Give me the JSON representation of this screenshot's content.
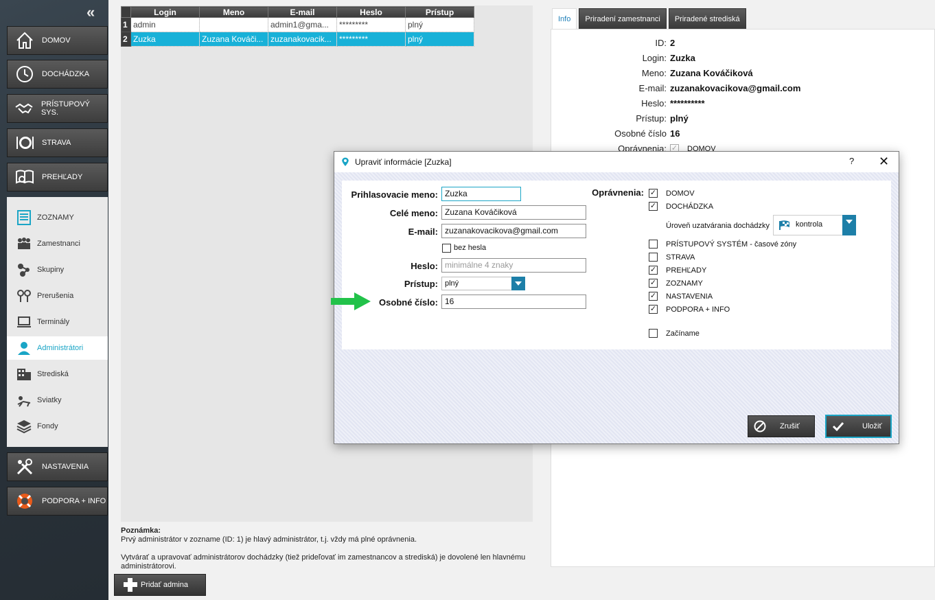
{
  "sidebar": {
    "collapse_icon": "«",
    "main_items": [
      {
        "label": "DOMOV",
        "icon": "home-icon"
      },
      {
        "label": "DOCHÁDZKA",
        "icon": "clock-icon"
      },
      {
        "label": "PRÍSTUPOVÝ SYS.",
        "icon": "handshake-icon"
      },
      {
        "label": "STRAVA",
        "icon": "plate-icon"
      },
      {
        "label": "PREHĽADY",
        "icon": "book-search-icon"
      }
    ],
    "sub_items": [
      {
        "label": "ZOZNAMY",
        "icon": "list-icon"
      },
      {
        "label": "Zamestnanci",
        "icon": "people-icon"
      },
      {
        "label": "Skupiny",
        "icon": "groups-icon"
      },
      {
        "label": "Prerušenia",
        "icon": "pins-icon"
      },
      {
        "label": "Terminály",
        "icon": "laptop-icon"
      },
      {
        "label": "Administrátori",
        "icon": "admin-user-icon"
      },
      {
        "label": "Strediská",
        "icon": "building-icon"
      },
      {
        "label": "Sviatky",
        "icon": "lounger-icon"
      },
      {
        "label": "Fondy",
        "icon": "layers-icon"
      }
    ],
    "bottom_items": [
      {
        "label": "NASTAVENIA",
        "icon": "tools-icon"
      },
      {
        "label": "PODPORA + INFO",
        "icon": "lifebuoy-icon"
      }
    ]
  },
  "grid": {
    "columns": [
      "Login",
      "Meno",
      "E-mail",
      "Heslo",
      "Prístup"
    ],
    "rows": [
      {
        "num": "1",
        "login": "admin",
        "meno": "",
        "email": "admin1@gma...",
        "heslo": "*********",
        "pristup": "plný"
      },
      {
        "num": "2",
        "login": "Zuzka",
        "meno": "Zuzana Kováči...",
        "email": "zuzanakovacik...",
        "heslo": "*********",
        "pristup": "plný"
      }
    ]
  },
  "note": {
    "title": "Poznámka:",
    "line1": "Prvý administrátor v zozname (ID: 1) je hlavý administrátor, t.j. vždy má plné oprávnenia.",
    "line2": "Vytvárať a upravovať administrátorov dochádzky (tiež prideľovať im zamestnancov a strediská) je dovolené len hlavnému administrátorovi."
  },
  "add_button": "Pridať admina",
  "tabs": [
    "Info",
    "Priradení zamestnanci",
    "Priradené strediská"
  ],
  "detail": [
    {
      "label": "ID:",
      "value": "2"
    },
    {
      "label": "Login:",
      "value": "Zuzka"
    },
    {
      "label": "Meno:",
      "value": "Zuzana Kováčiková"
    },
    {
      "label": "E-mail:",
      "value": "zuzanakovacikova@gmail.com"
    },
    {
      "label": "Heslo:",
      "value": "**********"
    },
    {
      "label": "Prístup:",
      "value": "plný"
    },
    {
      "label": "Osobné číslo",
      "value": "16"
    }
  ],
  "detail_perm": {
    "label": "Oprávnenia:",
    "item": "DOMOV"
  },
  "dialog": {
    "title": "Upraviť informácie [Zuzka]",
    "help": "?",
    "close": "✕",
    "fields": {
      "login_label": "Prihlasovacie meno:",
      "login_value": "Zuzka",
      "name_label": "Celé meno:",
      "name_value": "Zuzana Kováčiková",
      "email_label": "E-mail:",
      "email_value": "zuzanakovacikova@gmail.com",
      "nopass_label": "bez hesla",
      "pass_label": "Heslo:",
      "pass_placeholder": "minimálne 4 znaky",
      "access_label": "Prístup:",
      "access_value": "plný",
      "number_label": "Osobné číslo:",
      "number_value": "16"
    },
    "permissions_label": "Oprávnenia:",
    "permissions": [
      {
        "label": "DOMOV",
        "checked": true
      },
      {
        "label": "DOCHÁDZKA",
        "checked": true
      },
      {
        "label": "PRÍSTUPOVÝ SYSTÉM - časové zóny",
        "checked": false
      },
      {
        "label": "STRAVA",
        "checked": false
      },
      {
        "label": "PREHĽADY",
        "checked": true
      },
      {
        "label": "ZOZNAMY",
        "checked": true
      },
      {
        "label": "NASTAVENIA",
        "checked": true
      },
      {
        "label": "PODPORA + INFO",
        "checked": true
      },
      {
        "label": "Začíname",
        "checked": false
      }
    ],
    "level_label": "Úroveň uzatvárania dochádzky",
    "level_value": "kontrola",
    "cancel_label": "Zrušiť",
    "save_label": "Uložiť"
  },
  "colors": {
    "accent": "#1aa5c6",
    "selected_row": "#18b1d8",
    "arrow": "#22c24a"
  }
}
